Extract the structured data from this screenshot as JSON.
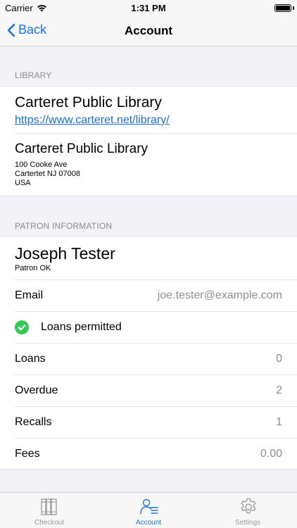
{
  "status_bar": {
    "carrier": "Carrier",
    "time": "1:31 PM"
  },
  "nav": {
    "back_label": "Back",
    "title": "Account"
  },
  "library_section": {
    "header": "LIBRARY",
    "name": "Carteret Public Library",
    "url": "https://www.carteret.net/library/",
    "branch_name": "Carteret Public Library",
    "address": [
      "100 Cooke Ave",
      "Cartertet NJ 07008",
      "USA"
    ]
  },
  "patron_section": {
    "header": "PATRON INFORMATION",
    "name": "Joseph Tester",
    "status": "Patron OK",
    "email_label": "Email",
    "email_value": "joe.tester@example.com",
    "loans_permitted": "Loans permitted",
    "rows": [
      {
        "label": "Loans",
        "value": "0"
      },
      {
        "label": "Overdue",
        "value": "2"
      },
      {
        "label": "Recalls",
        "value": "1"
      },
      {
        "label": "Fees",
        "value": "0.00"
      }
    ]
  },
  "tabs": [
    {
      "label": "Checkout",
      "icon": "books-icon"
    },
    {
      "label": "Account",
      "icon": "account-list-icon"
    },
    {
      "label": "Settings",
      "icon": "gear-icon"
    }
  ],
  "colors": {
    "accent": "#1a73e8",
    "success": "#34c759"
  }
}
